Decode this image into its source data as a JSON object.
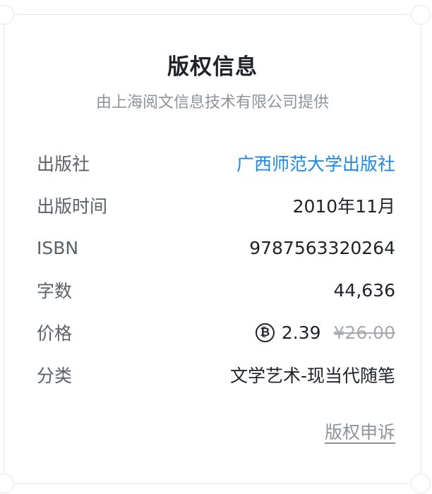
{
  "header": {
    "title": "版权信息",
    "subtitle": "由上海阅文信息技术有限公司提供"
  },
  "rows": [
    {
      "label": "出版社",
      "value": "广西师范大学出版社"
    },
    {
      "label": "出版时间",
      "value": "2010年11月"
    },
    {
      "label": "ISBN",
      "value": "9787563320264"
    },
    {
      "label": "字数",
      "value": "44,636"
    },
    {
      "label": "价格",
      "price": "2.39",
      "original_price": "¥26.00",
      "coin_symbol": "₿"
    },
    {
      "label": "分类",
      "value": "文学艺术-现当代随笔"
    }
  ],
  "footer": {
    "link_label": "版权申诉"
  },
  "colors": {
    "link": "#1e88e5",
    "label": "#5b6069",
    "muted": "#8e9299"
  }
}
